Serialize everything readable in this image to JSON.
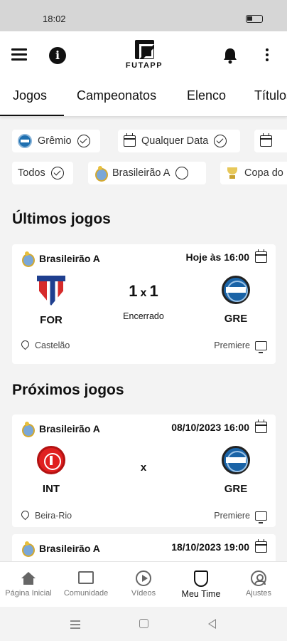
{
  "status_bar": {
    "time": "18:02"
  },
  "app": {
    "logo_text": "FUTAPP"
  },
  "tabs": [
    "Jogos",
    "Campeonatos",
    "Elenco",
    "Títulos"
  ],
  "filters": {
    "row1": [
      {
        "label": "Grêmio",
        "icon": "gremio-crest-icon",
        "checked": true
      },
      {
        "label": "Qualquer Data",
        "icon": "calendar-icon",
        "checked": true
      },
      {
        "label": "",
        "icon": "calendar-icon"
      }
    ],
    "row2": [
      {
        "label": "Todos",
        "checked": true
      },
      {
        "label": "Brasileirão A",
        "icon": "brasileirao-crest-icon",
        "checked": false
      },
      {
        "label": "Copa do",
        "icon": "trophy-icon"
      }
    ]
  },
  "sections": {
    "last_games_title": "Últimos jogos",
    "next_games_title": "Próximos jogos"
  },
  "last_games": [
    {
      "competition": "Brasileirão A",
      "datetime": "Hoje às 16:00",
      "home": {
        "abbr": "FOR",
        "crest": "fortaleza-crest-icon"
      },
      "away": {
        "abbr": "GRE",
        "crest": "gremio-crest-icon"
      },
      "home_score": "1",
      "separator": "x",
      "away_score": "1",
      "status": "Encerrado",
      "venue": "Castelão",
      "broadcaster": "Premiere"
    }
  ],
  "next_games": [
    {
      "competition": "Brasileirão A",
      "datetime": "08/10/2023 16:00",
      "home": {
        "abbr": "INT",
        "crest": "internacional-crest-icon"
      },
      "away": {
        "abbr": "GRE",
        "crest": "gremio-crest-icon"
      },
      "separator": "x",
      "venue": "Beira-Rio",
      "broadcaster": "Premiere"
    },
    {
      "competition": "Brasileirão A",
      "datetime": "18/10/2023 19:00"
    }
  ],
  "bottom_nav": [
    {
      "label": "Página Inicial",
      "icon": "home-icon"
    },
    {
      "label": "Comunidade",
      "icon": "chat-icon"
    },
    {
      "label": "Vídeos",
      "icon": "play-icon"
    },
    {
      "label": "Meu Time",
      "icon": "shield-icon",
      "active": true
    },
    {
      "label": "Ajustes",
      "icon": "settings-icon"
    }
  ],
  "colors": {
    "accent": "#111111",
    "background": "#f3f3f3",
    "card": "#ffffff"
  }
}
